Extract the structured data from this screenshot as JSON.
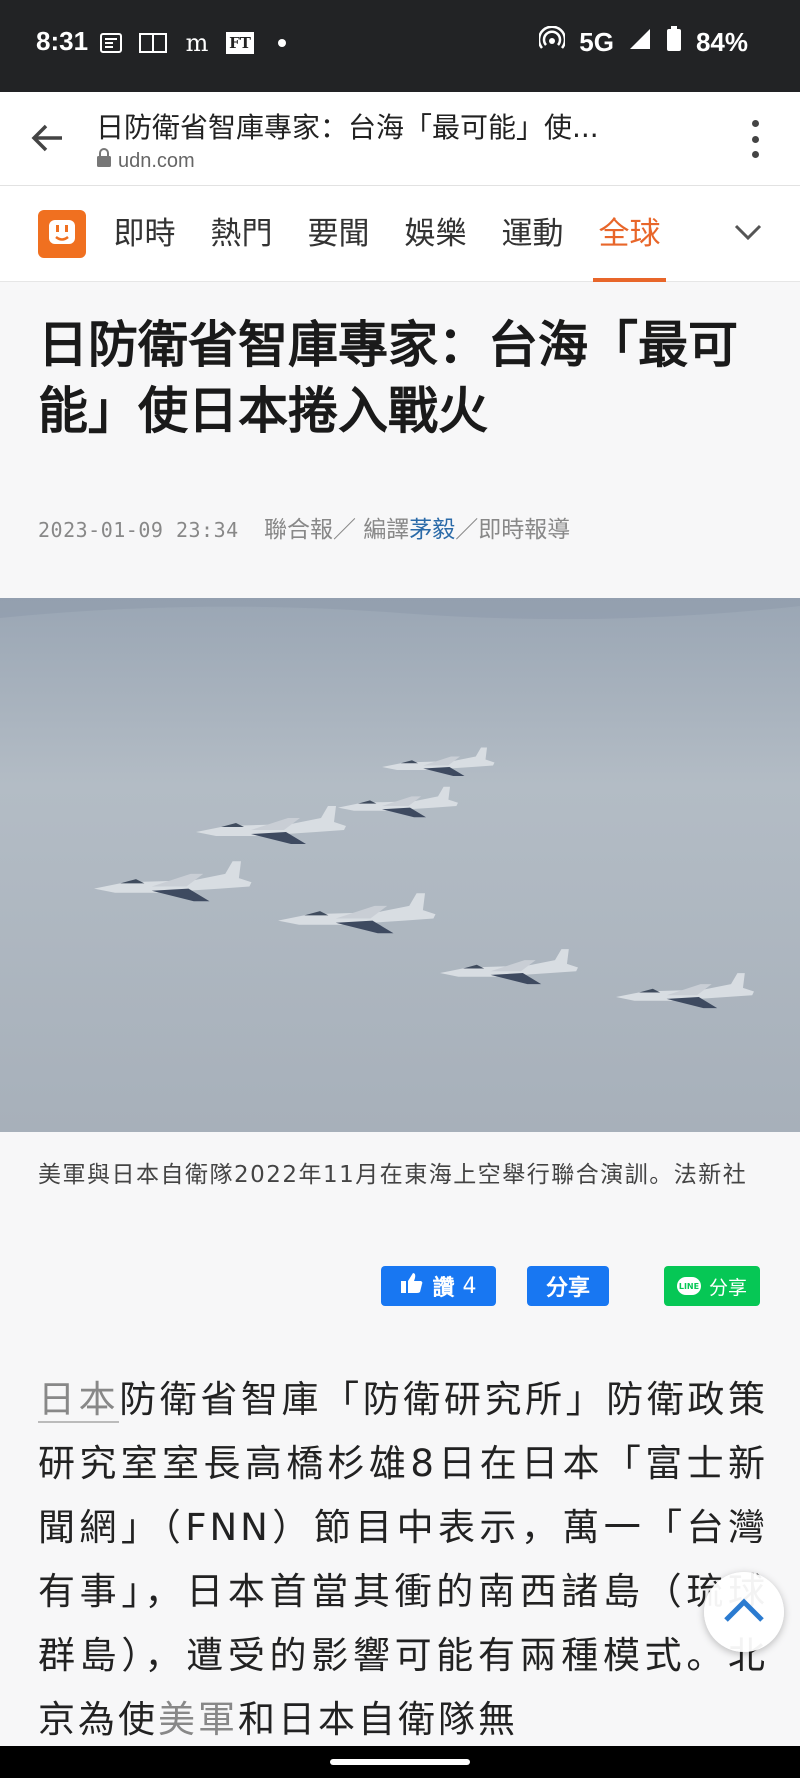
{
  "status": {
    "time": "8:31",
    "network": "5G",
    "battery": "84%",
    "notif_ft": "FT"
  },
  "browser": {
    "page_title": "日防衛省智庫專家：台海「最可能」使...",
    "domain": "udn.com"
  },
  "nav": {
    "items": [
      "即時",
      "熱門",
      "要聞",
      "娛樂",
      "運動",
      "全球"
    ],
    "active_index": 5,
    "accent_color": "#e8662a"
  },
  "article": {
    "headline": "日防衛省智庫專家：台海「最可能」使日本捲入戰火",
    "date": "2023-01-09 23:34",
    "source": "聯合報／ 編譯",
    "author": "茅毅",
    "section": "／即時報導",
    "caption": "美軍與日本自衛隊2022年11月在東海上空舉行聯合演訓。法新社",
    "body_tag1": "日本",
    "body_part1": "防衛省智庫「防衛研究所」防衛政策研究室室長高橋杉雄8日在日本「富士新聞網」（FNN）節目中表示，萬一「台灣有事」，日本首當其衝的南西諸島（琉球群島），遭受的影響可能有兩種模式。北京為使",
    "body_tag2": "美軍",
    "body_part2": "和日本自衛隊無"
  },
  "share": {
    "like_label": "讚",
    "like_count": "4",
    "share_label": "分享",
    "line_label": "分享",
    "line_badge": "LINE"
  }
}
